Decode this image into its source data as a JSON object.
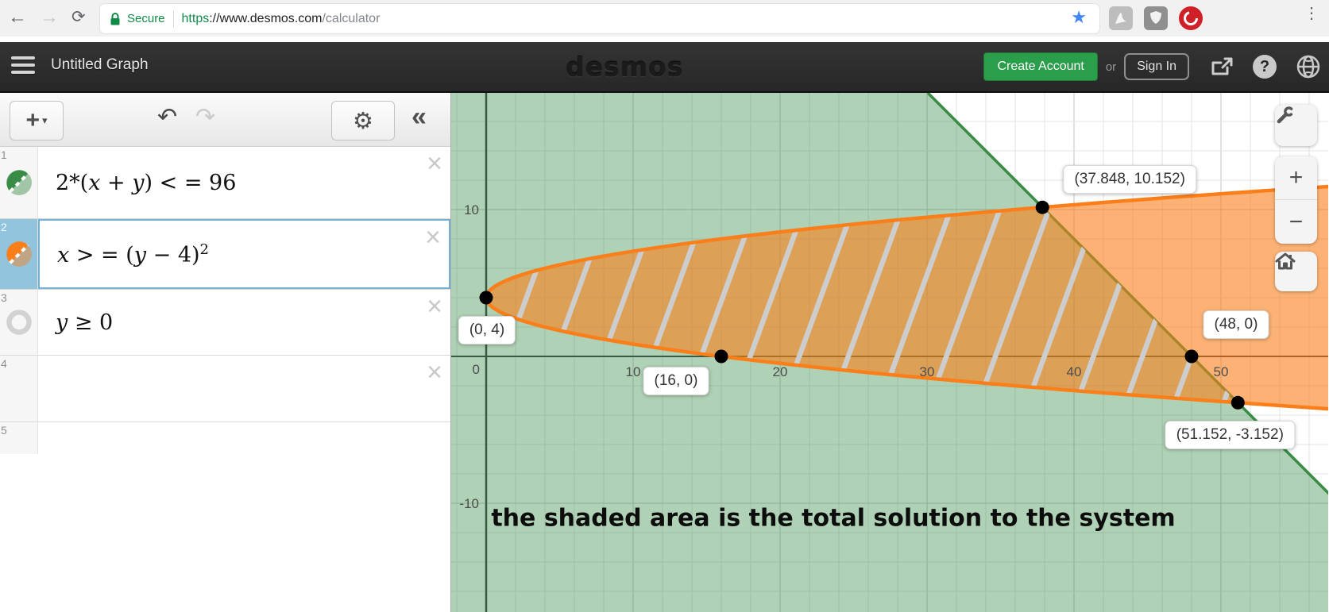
{
  "browser": {
    "secure_label": "Secure",
    "url": {
      "scheme": "https",
      "host": "://www.desmos.com",
      "path": "/calculator"
    }
  },
  "header": {
    "title": "Untitled Graph",
    "logo": "desmos",
    "create_account_label": "Create Account",
    "or_label": "or",
    "sign_in_label": "Sign In"
  },
  "expressions": {
    "rows": [
      {
        "index": "1",
        "latex": "2*(x + y) < = 96",
        "color": "#388c46",
        "style": "inequality",
        "selected": false
      },
      {
        "index": "2",
        "latex": "x > = (y − 4)^2",
        "color": "#fa7e19",
        "style": "inequality",
        "selected": true
      },
      {
        "index": "3",
        "latex": "y ≥ 0",
        "color": "#c9c9c9",
        "style": "hidden",
        "selected": false
      },
      {
        "index": "4",
        "latex": "",
        "color": "",
        "style": "empty",
        "selected": false
      },
      {
        "index": "5",
        "latex": "",
        "color": "",
        "style": "blank",
        "selected": false
      }
    ]
  },
  "graph_controls": {
    "zoom_in": "+",
    "zoom_out": "−"
  },
  "chart_data": {
    "type": "region-plot",
    "title": "Desmos graph of a system of inequalities",
    "equations": [
      "2*(x+y) <= 96",
      "x >= (y-4)^2",
      "y >= 0 (hidden)"
    ],
    "x_range": [
      -2.4,
      57.4
    ],
    "y_range": [
      -17.4,
      17.9
    ],
    "grid": {
      "minor_step": 2,
      "major_step": 10
    },
    "x_ticks": [
      {
        "value": 0,
        "label": "0"
      },
      {
        "value": 10,
        "label": "10"
      },
      {
        "value": 20,
        "label": "20"
      },
      {
        "value": 30,
        "label": "30"
      },
      {
        "value": 40,
        "label": "40"
      },
      {
        "value": 50,
        "label": "50"
      }
    ],
    "y_ticks": [
      {
        "value": 10,
        "label": "10"
      },
      {
        "value": -10,
        "label": "-10"
      }
    ],
    "regions": [
      {
        "name": "half-plane 2(x+y)<=96",
        "color": "#388c46",
        "fill_opacity": 0.4
      },
      {
        "name": "parabola interior x>=(y-4)^2",
        "color": "#fa7e19",
        "fill_opacity": 0.6
      },
      {
        "name": "overlap (solution)",
        "pattern": "gray diagonal hatch",
        "hatch_color": "#cdcdcd"
      }
    ],
    "points": [
      {
        "x": 0,
        "y": 4,
        "label": "(0, 4)"
      },
      {
        "x": 16,
        "y": 0,
        "label": "(16, 0)"
      },
      {
        "x": 48,
        "y": 0,
        "label": "(48, 0)"
      },
      {
        "x": 37.848,
        "y": 10.152,
        "label": "(37.848, 10.152)"
      },
      {
        "x": 51.152,
        "y": -3.152,
        "label": "(51.152, -3.152)"
      }
    ],
    "annotation": "the shaded area is the total solution to the system",
    "colors": {
      "green": "#388c46",
      "orange": "#fa7e19",
      "point": "#000000"
    }
  }
}
